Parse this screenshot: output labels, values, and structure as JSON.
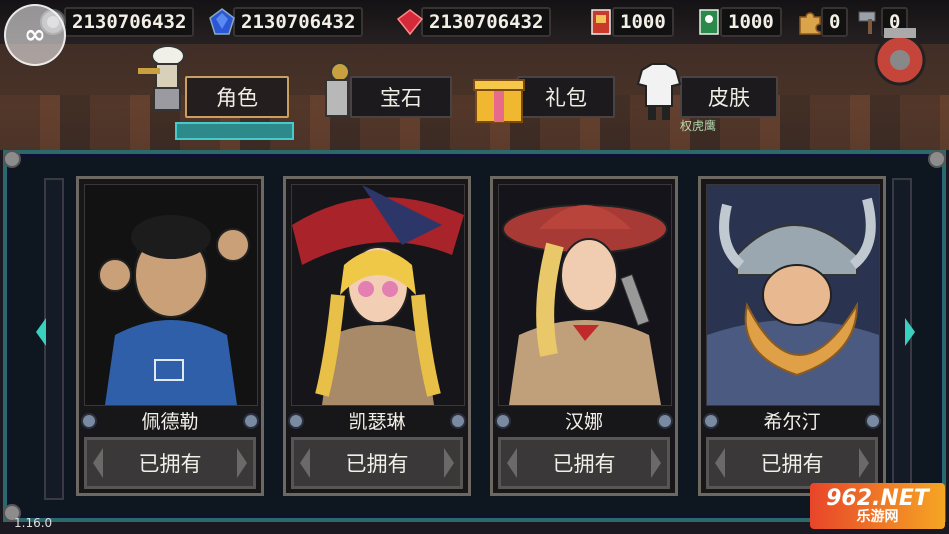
{
  "resources": {
    "coin": "2130706432",
    "sapphire": "2130706432",
    "ruby": "2130706432",
    "ticket_red": "1000",
    "ticket_green": "1000",
    "puzzle": "0",
    "hammer": "0"
  },
  "tabs": [
    {
      "label": "角色",
      "active": true
    },
    {
      "label": "宝石",
      "active": false
    },
    {
      "label": "礼包",
      "active": false
    },
    {
      "label": "皮肤",
      "active": false
    }
  ],
  "skin_sublabel": "权虎鹰",
  "characters": [
    {
      "name": "佩德勒",
      "status": "已拥有"
    },
    {
      "name": "凯瑟琳",
      "status": "已拥有"
    },
    {
      "name": "汉娜",
      "status": "已拥有"
    },
    {
      "name": "希尔汀",
      "status": "已拥有"
    }
  ],
  "version": "1.16.0",
  "watermark": {
    "line1": "962.NET",
    "line2": "乐游网"
  },
  "colors": {
    "accent_teal": "#2a6a6a",
    "tab_active_border": "#c9a062"
  }
}
